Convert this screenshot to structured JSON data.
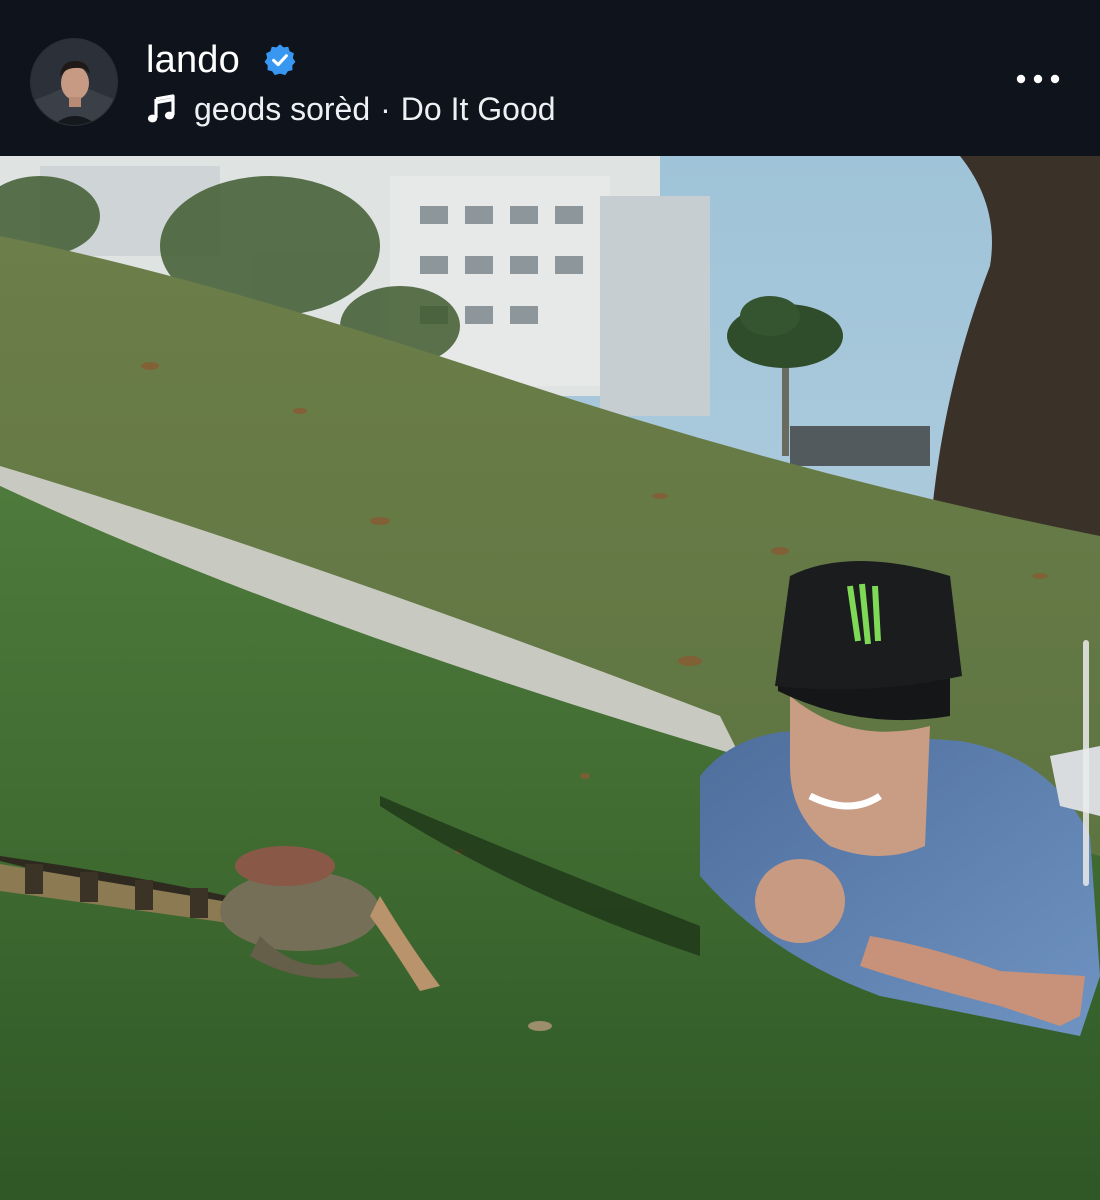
{
  "post": {
    "username": "lando",
    "verified": true,
    "music": {
      "icon": "music-note-icon",
      "artist": "geods sorèd",
      "separator": "·",
      "track": "Do It Good"
    },
    "more_icon": "more-horizontal-icon"
  },
  "colors": {
    "header_bg": "#0f131b",
    "verified_badge": "#3897f0",
    "text": "#ffffff"
  }
}
